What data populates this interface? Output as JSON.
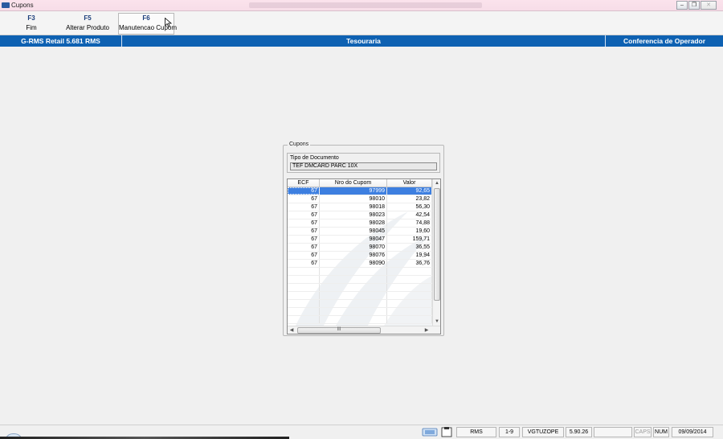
{
  "window": {
    "title": "Cupons",
    "buttons": {
      "minimize": "‒",
      "maximize": "❐",
      "close": "✕"
    }
  },
  "toolbar": {
    "keys": [
      {
        "key": "F3",
        "label": "Fim"
      },
      {
        "key": "F5",
        "label": "Alterar Produto"
      },
      {
        "key": "F6",
        "label": "Manutencao Cupom"
      }
    ]
  },
  "header": {
    "left": "G-RMS Retail 5.681 RMS",
    "center": "Tesouraria",
    "right": "Conferencia de Operador"
  },
  "dialog": {
    "legend": "Cupons",
    "tipo_label": "Tipo de Documento",
    "tipo_value": "TEF DMCARD PARC 10X",
    "columns": [
      "ECF",
      "Nro do Cupom",
      "Valor"
    ],
    "rows": [
      {
        "ecf": "67",
        "nro": "97999",
        "valor": "92,65"
      },
      {
        "ecf": "67",
        "nro": "98010",
        "valor": "23,82"
      },
      {
        "ecf": "67",
        "nro": "98018",
        "valor": "56,30"
      },
      {
        "ecf": "67",
        "nro": "98023",
        "valor": "42,54"
      },
      {
        "ecf": "67",
        "nro": "98028",
        "valor": "74,88"
      },
      {
        "ecf": "67",
        "nro": "98045",
        "valor": "19,60"
      },
      {
        "ecf": "67",
        "nro": "98047",
        "valor": "159,71"
      },
      {
        "ecf": "67",
        "nro": "98070",
        "valor": "36,55"
      },
      {
        "ecf": "67",
        "nro": "98076",
        "valor": "19,94"
      },
      {
        "ecf": "67",
        "nro": "98090",
        "valor": "36,76"
      }
    ],
    "selected_row": 0,
    "hscroll_thumb": "III"
  },
  "status": {
    "system": "RMS",
    "range": "1-9",
    "user": "VGTUZOPE",
    "version": "5.90.26",
    "caps": "CAPS",
    "num": "NUM",
    "date": "09/09/2014"
  },
  "colors": {
    "header_bar": "#0e61b2",
    "selection": "#3d7fe0",
    "fkey_text": "#1a3d7a"
  }
}
